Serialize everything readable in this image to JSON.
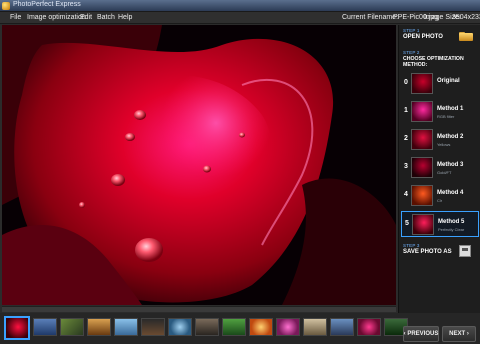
{
  "window": {
    "title": "PhotoPerfect Express"
  },
  "menu": [
    {
      "label": "File"
    },
    {
      "label": "Image optimization"
    },
    {
      "label": "Edit"
    },
    {
      "label": "Batch"
    },
    {
      "label": "Help"
    }
  ],
  "status": {
    "filename_label": "Current Filename:",
    "filename": "PPE-Pic00.jpg",
    "size_label": "Image Size:",
    "size": "3504x2336"
  },
  "panel": {
    "step1": {
      "num": "STEP 1",
      "title": "OPEN PHOTO",
      "icon": "folder-icon"
    },
    "step2": {
      "num": "STEP 2",
      "title": "CHOOSE OPTIMIZATION METHOD:"
    },
    "methods": [
      {
        "num": "0",
        "name": "Original",
        "sub": ""
      },
      {
        "num": "1",
        "name": "Method 1",
        "sub": "RGB filter"
      },
      {
        "num": "2",
        "name": "Method 2",
        "sub": "Yellows"
      },
      {
        "num": "3",
        "name": "Method 3",
        "sub": "Gold/FT"
      },
      {
        "num": "4",
        "name": "Method 4",
        "sub": "Clr"
      },
      {
        "num": "5",
        "name": "Method 5",
        "sub": "Perfectly Clear"
      }
    ],
    "selected_method": 5,
    "step3": {
      "num": "STEP 3",
      "title": "SAVE PHOTO AS",
      "icon": "save-icon"
    }
  },
  "nav": {
    "previous": "PREVIOUS",
    "next": "NEXT"
  },
  "colors": {
    "accent": "#3aa1ff",
    "step_label": "#6fb2ff"
  }
}
